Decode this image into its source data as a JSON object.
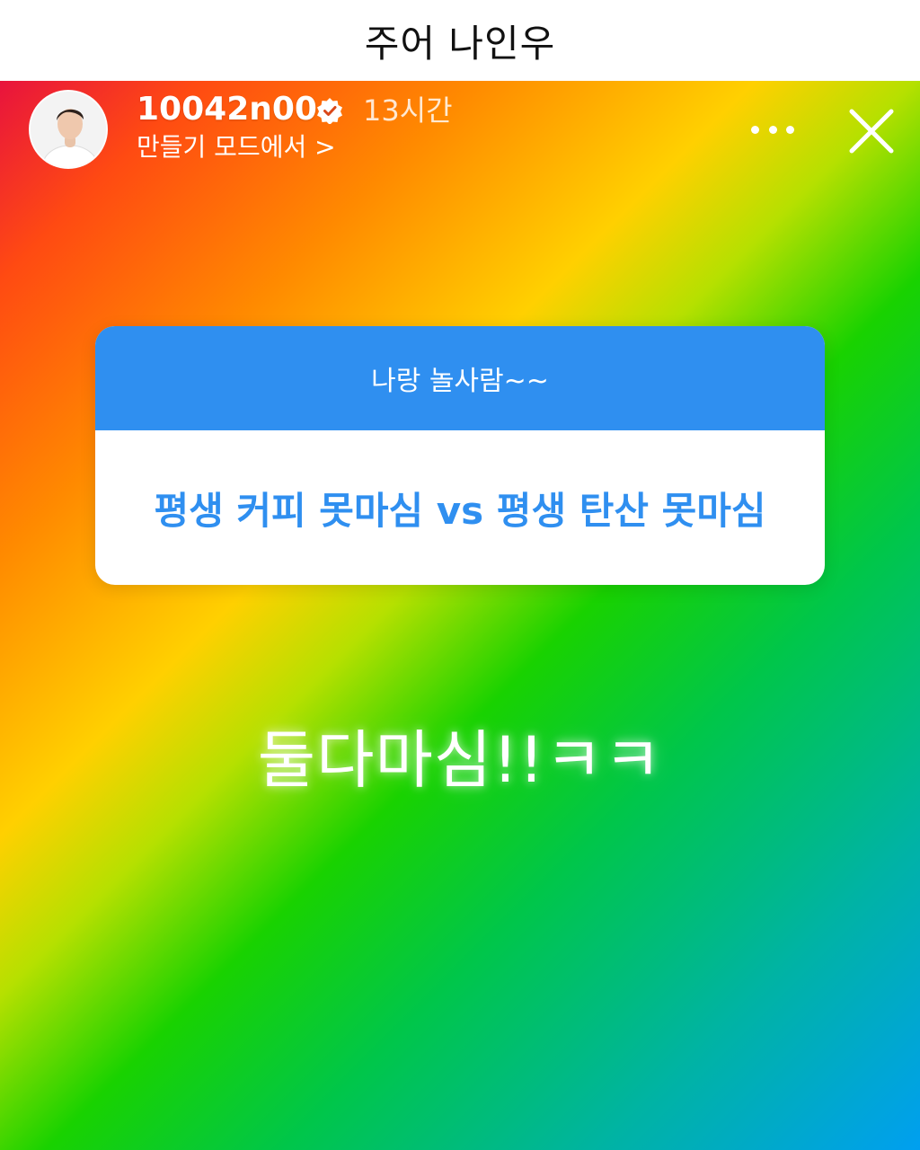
{
  "caption": "주어 나인우",
  "story": {
    "username": "10042n00",
    "timestamp": "13시간",
    "subtitle": "만들기 모드에서 >",
    "more_icon": "more-horizontal-icon",
    "close_icon": "close-icon",
    "verified_icon": "verified-badge-icon",
    "question": {
      "prompt": "나랑 놀사람~~",
      "text": "평생 커피 못마심 vs 평생 탄산 못마심"
    },
    "answer": "둘다마심!!ㅋㅋ",
    "colors": {
      "question_header": "#2f8ff0",
      "question_text": "#2f8ff0",
      "card_background": "#ffffff",
      "text_on_story": "#ffffff"
    }
  }
}
